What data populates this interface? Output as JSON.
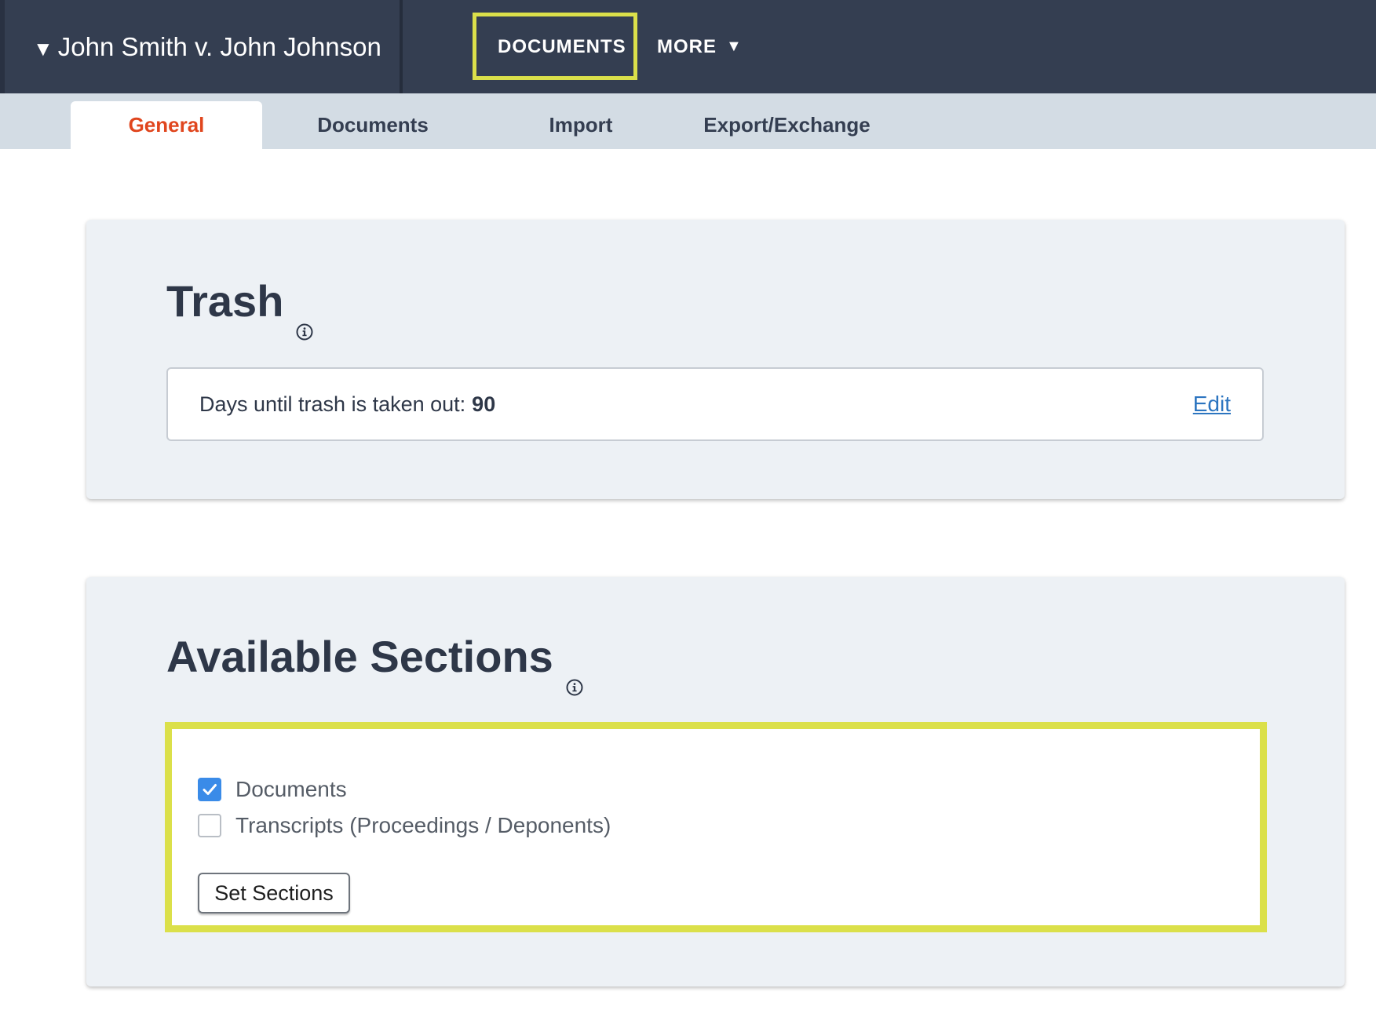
{
  "header": {
    "case_caret": "▼",
    "case_title": "John Smith v. John Johnson",
    "nav": {
      "documents_label": "DOCUMENTS",
      "more_label": "MORE",
      "more_caret": "▼"
    }
  },
  "subnav": {
    "tabs": [
      {
        "label": "General",
        "active": true
      },
      {
        "label": "Documents",
        "active": false
      },
      {
        "label": "Import",
        "active": false
      },
      {
        "label": "Export/Exchange",
        "active": false
      }
    ]
  },
  "trash": {
    "title": "Trash",
    "days_label": "Days until trash is taken out:",
    "days_value": "90",
    "edit_label": "Edit"
  },
  "sections": {
    "title": "Available Sections",
    "options": [
      {
        "label": "Documents",
        "checked": true
      },
      {
        "label": "Transcripts (Proceedings / Deponents)",
        "checked": false
      }
    ],
    "button_label": "Set Sections"
  },
  "colors": {
    "header_bg": "#343e51",
    "subnav_bg": "#d3dce4",
    "active_tab_text": "#e0461e",
    "highlight": "#dbe04a",
    "link": "#2c75c0",
    "checkbox_checked": "#3a8be8",
    "card_bg": "#edf1f5"
  },
  "icons": [
    "caret-down-icon",
    "info-icon",
    "checkmark-icon"
  ]
}
